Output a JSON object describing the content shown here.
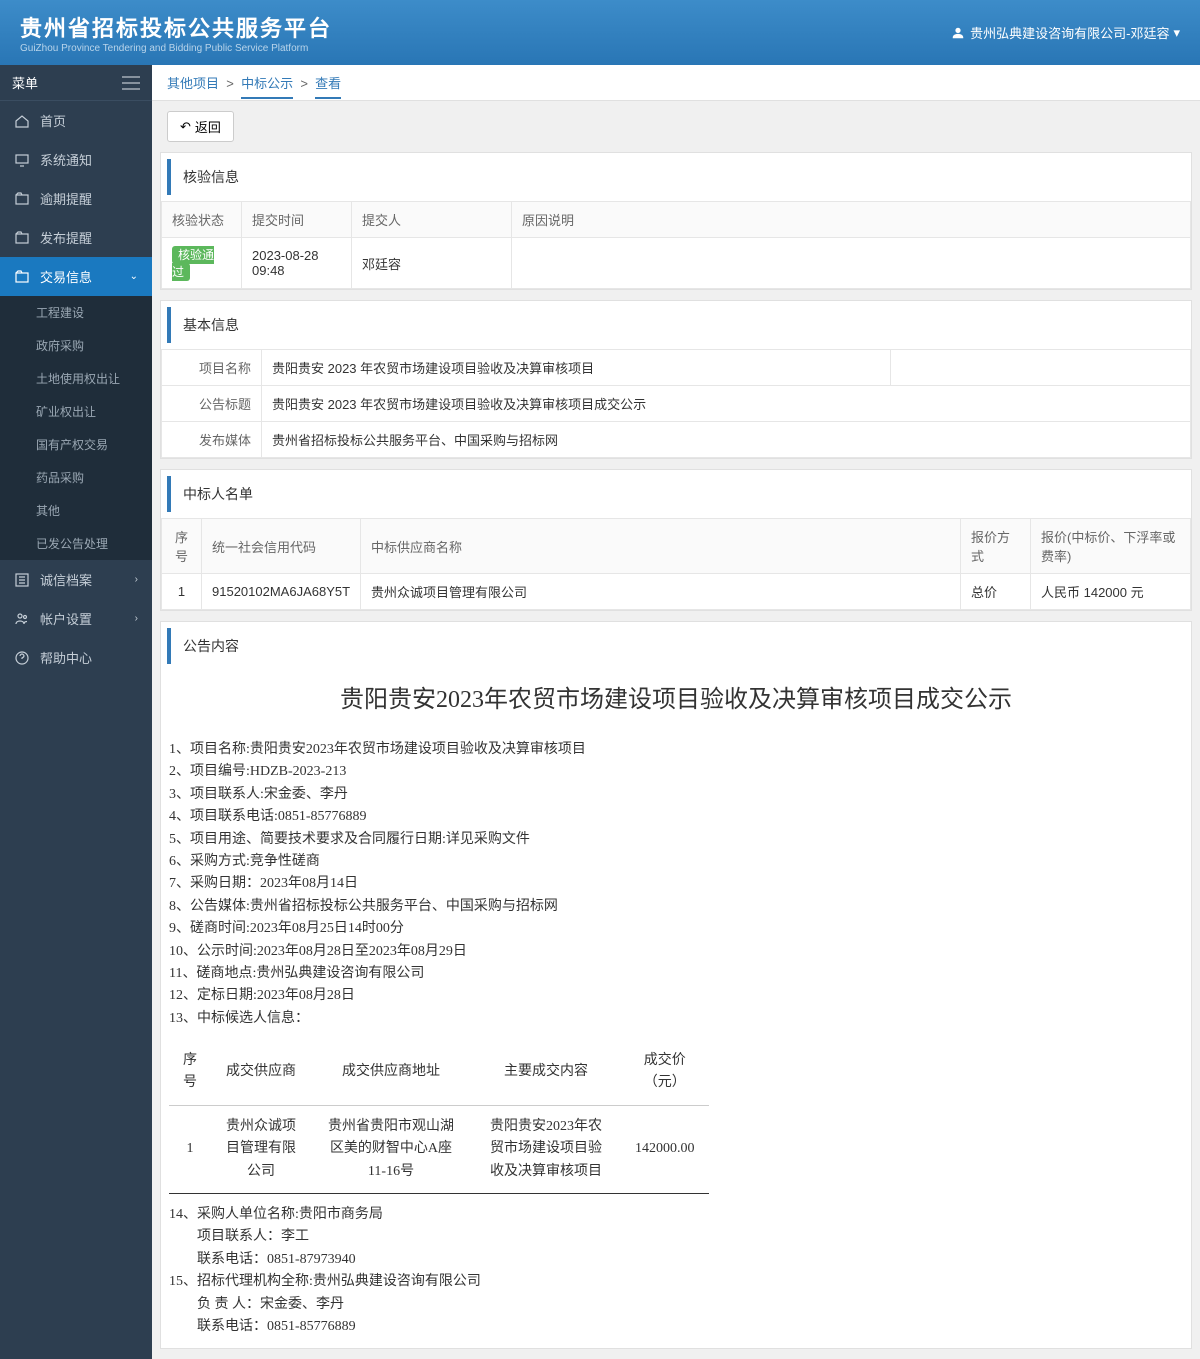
{
  "header": {
    "title": "贵州省招标投标公共服务平台",
    "subtitle": "GuiZhou Province Tendering and Bidding Public Service Platform",
    "user": "贵州弘典建设咨询有限公司-邓廷容"
  },
  "sidebar": {
    "menu_label": "菜单",
    "items": [
      {
        "label": "首页"
      },
      {
        "label": "系统通知"
      },
      {
        "label": "逾期提醒"
      },
      {
        "label": "发布提醒"
      },
      {
        "label": "交易信息",
        "active": true
      },
      {
        "label": "诚信档案"
      },
      {
        "label": "帐户设置"
      },
      {
        "label": "帮助中心"
      }
    ],
    "sub_items": [
      {
        "label": "工程建设"
      },
      {
        "label": "政府采购"
      },
      {
        "label": "土地使用权出让"
      },
      {
        "label": "矿业权出让"
      },
      {
        "label": "国有产权交易"
      },
      {
        "label": "药品采购"
      },
      {
        "label": "其他"
      },
      {
        "label": "已发公告处理"
      }
    ]
  },
  "breadcrumb": {
    "item1": "其他项目",
    "item2": "中标公示",
    "item3": "查看",
    "sep": ">"
  },
  "back_btn": "返回",
  "verify": {
    "title": "核验信息",
    "headers": {
      "status": "核验状态",
      "time": "提交时间",
      "submitter": "提交人",
      "reason": "原因说明"
    },
    "row": {
      "status": "核验通过",
      "time": "2023-08-28 09:48",
      "submitter": "邓廷容",
      "reason": ""
    }
  },
  "basic": {
    "title": "基本信息",
    "fields": {
      "project_name_label": "项目名称",
      "project_name": "贵阳贵安 2023 年农贸市场建设项目验收及决算审核项目",
      "notice_title_label": "公告标题",
      "notice_title": "贵阳贵安 2023 年农贸市场建设项目验收及决算审核项目成交公示",
      "media_label": "发布媒体",
      "media": "贵州省招标投标公共服务平台、中国采购与招标网"
    }
  },
  "winners": {
    "title": "中标人名单",
    "headers": {
      "seq": "序号",
      "code": "统一社会信用代码",
      "name": "中标供应商名称",
      "method": "报价方式",
      "price": "报价(中标价、下浮率或费率)"
    },
    "row": {
      "seq": "1",
      "code": "91520102MA6JA68Y5T",
      "name": "贵州众诚项目管理有限公司",
      "method": "总价",
      "price": "人民币 142000 元"
    }
  },
  "announce": {
    "section_title": "公告内容",
    "title": "贵阳贵安2023年农贸市场建设项目验收及决算审核项目成交公示",
    "lines": [
      "1、项目名称:贵阳贵安2023年农贸市场建设项目验收及决算审核项目",
      "2、项目编号:HDZB-2023-213",
      "3、项目联系人:宋金委、李丹",
      "4、项目联系电话:0851-85776889",
      "5、项目用途、简要技术要求及合同履行日期:详见采购文件",
      "6、采购方式:竞争性磋商",
      "7、采购日期：2023年08月14日",
      "8、公告媒体:贵州省招标投标公共服务平台、中国采购与招标网",
      "9、磋商时间:2023年08月25日14时00分",
      "10、公示时间:2023年08月28日至2023年08月29日",
      "11、磋商地点:贵州弘典建设咨询有限公司",
      "12、定标日期:2023年08月28日",
      "13、中标候选人信息："
    ],
    "inner_table": {
      "headers": {
        "seq": "序号",
        "supplier": "成交供应商",
        "address": "成交供应商地址",
        "content": "主要成交内容",
        "price": "成交价（元）"
      },
      "row": {
        "seq": "1",
        "supplier": "贵州众诚项目管理有限公司",
        "address": "贵州省贵阳市观山湖区美的财智中心A座11-16号",
        "content": "贵阳贵安2023年农贸市场建设项目验收及决算审核项目",
        "price": "142000.00"
      }
    },
    "footer_lines": [
      "14、采购人单位名称:贵阳市商务局",
      "项目联系人：李工",
      "联系电话：0851-87973940",
      "15、招标代理机构全称:贵州弘典建设咨询有限公司",
      "负 责 人：宋金委、李丹",
      "联系电话：0851-85776889"
    ]
  }
}
